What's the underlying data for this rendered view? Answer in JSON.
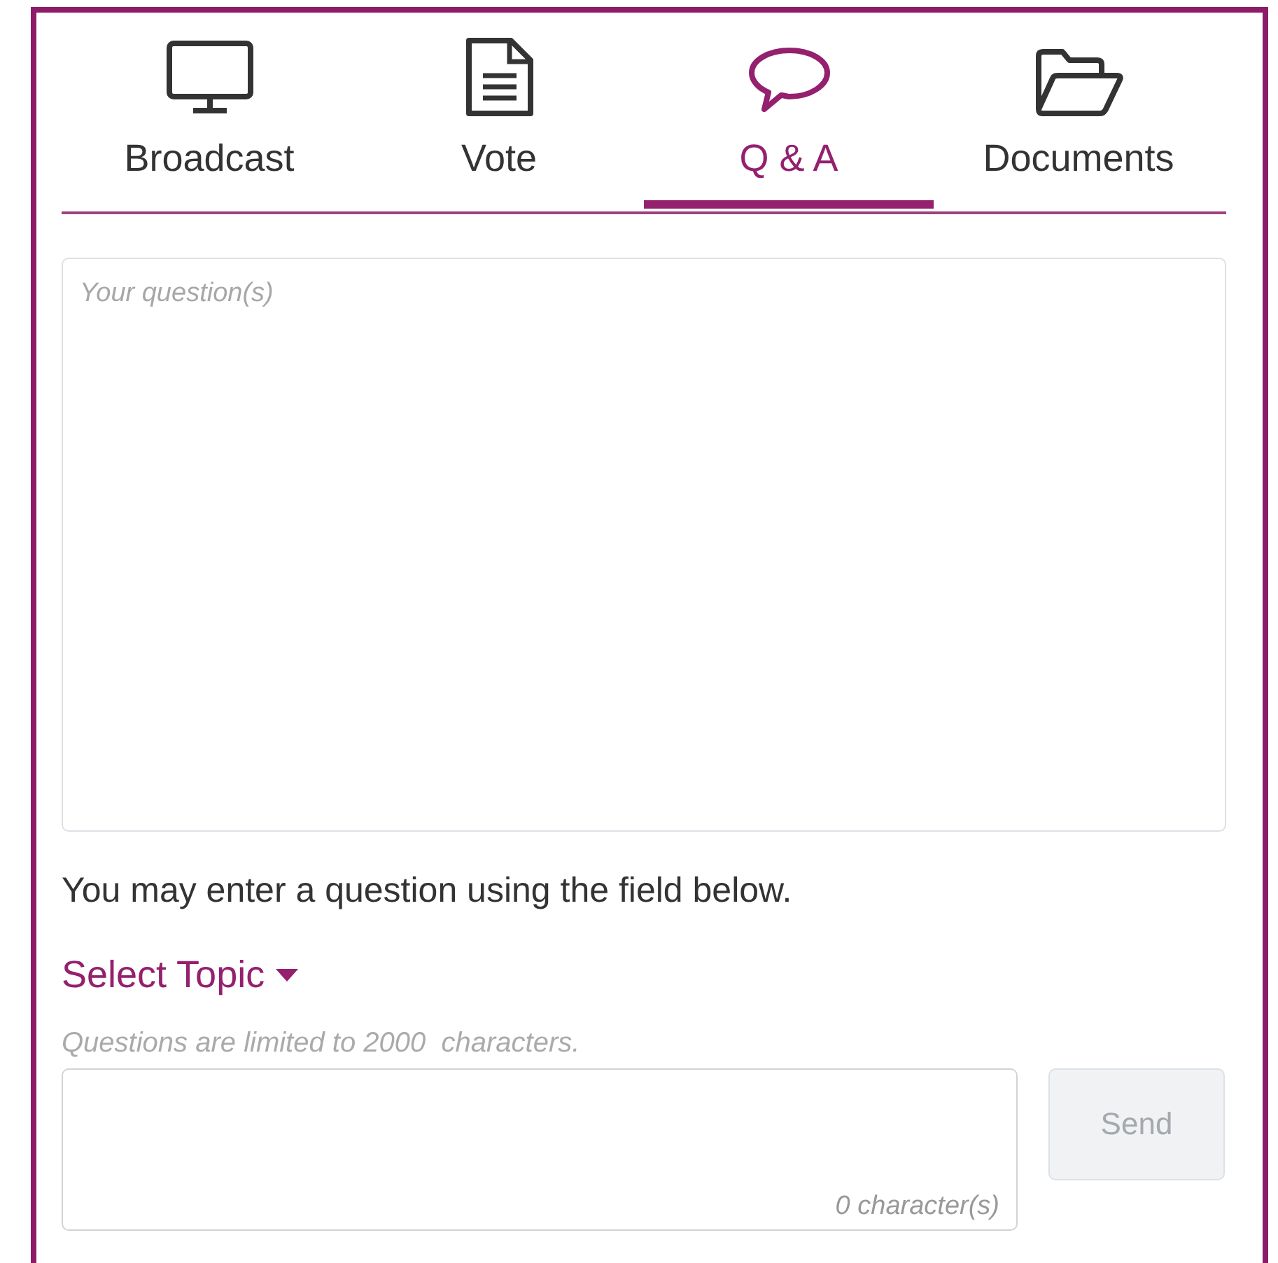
{
  "tabs": [
    {
      "label": "Broadcast",
      "selected": false
    },
    {
      "label": "Vote",
      "selected": false
    },
    {
      "label": "Q & A",
      "selected": true
    },
    {
      "label": "Documents",
      "selected": false
    }
  ],
  "question_field": {
    "placeholder": "Your question(s)"
  },
  "instruction": "You may enter a question using the field below.",
  "topic_select": {
    "label": "Select Topic"
  },
  "limit_hint": "Questions are limited to 2000  characters.",
  "entry_field": {
    "counter": "0 character(s)"
  },
  "send_button": {
    "label": "Send",
    "disabled": true
  }
}
